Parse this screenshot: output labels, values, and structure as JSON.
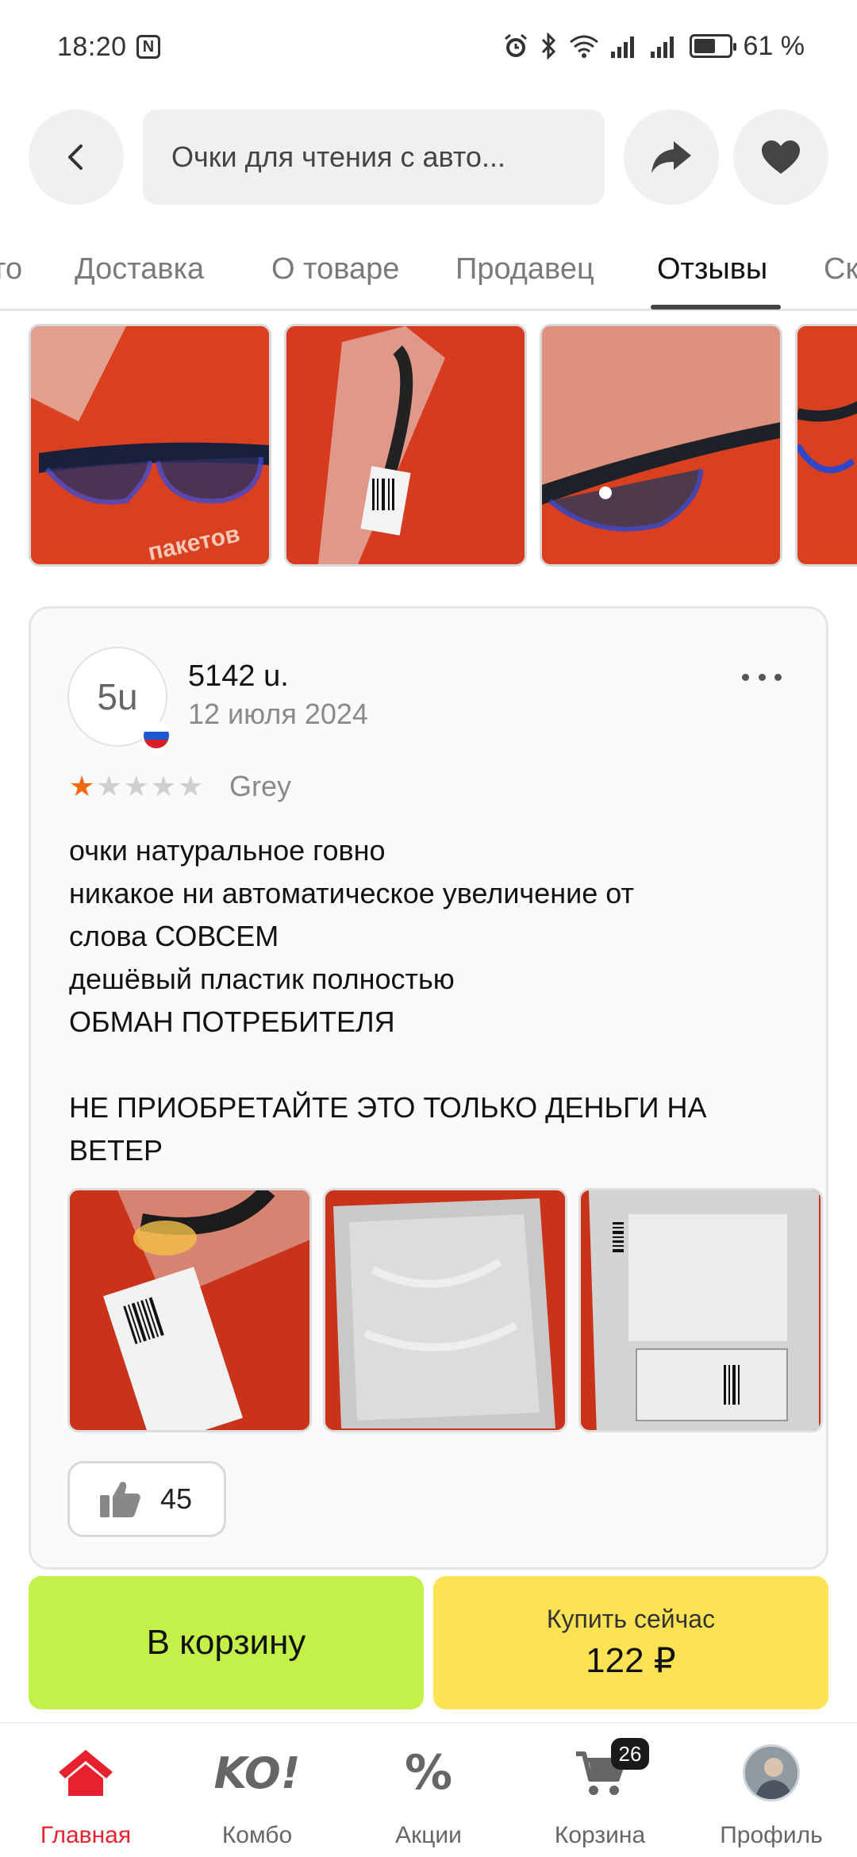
{
  "status_bar": {
    "time": "18:20",
    "nfc_icon": "N",
    "battery_percent": "61 %",
    "battery_level": 0.61,
    "icons": [
      "alarm-icon",
      "bluetooth-icon",
      "wifi-icon",
      "signal-icon",
      "signal-icon",
      "battery-icon"
    ]
  },
  "header": {
    "search_text": "Очки для чтения с авто..."
  },
  "tabs": [
    {
      "label": "то"
    },
    {
      "label": "Доставка"
    },
    {
      "label": "О товаре"
    },
    {
      "label": "Продавец"
    },
    {
      "label": "Отзывы"
    },
    {
      "label": "Ск"
    }
  ],
  "active_tab_index": 4,
  "gallery_watermark": "пакетов",
  "review": {
    "avatar_initials": "5u",
    "author": "5142 u.",
    "date": "12 июля 2024",
    "rating": 1,
    "rating_max": 5,
    "variant": "Grey",
    "text_lines": [
      "очки натуральное говно",
      "никакое ни автоматическое увеличение от",
      "слова СОВСЕМ",
      "дешёвый пластик полностью",
      "ОБМАН ПОТРЕБИТЕЛЯ",
      "",
      "НЕ ПРИОБРЕТАЙТЕ ЭТО ТОЛЬКО ДЕНЬГИ НА",
      "ВЕТЕР"
    ],
    "likes": "45"
  },
  "actions": {
    "cart_label": "В корзину",
    "buy_label": "Купить сейчас",
    "price": "122 ₽"
  },
  "bottom_nav": {
    "items": [
      {
        "label": "Главная",
        "icon": "home-icon",
        "active": true
      },
      {
        "label": "Комбо",
        "icon": "combo-icon",
        "icon_text": "KO!"
      },
      {
        "label": "Акции",
        "icon": "percent-icon",
        "icon_text": "%"
      },
      {
        "label": "Корзина",
        "icon": "cart-icon",
        "badge": "26"
      },
      {
        "label": "Профиль",
        "icon": "profile-avatar"
      }
    ]
  },
  "colors": {
    "cart_button": "#c4f04a",
    "buy_button": "#fde254",
    "active_nav": "#e8212e",
    "star_filled": "#f06a14",
    "photo_background": "#d63a1f"
  }
}
